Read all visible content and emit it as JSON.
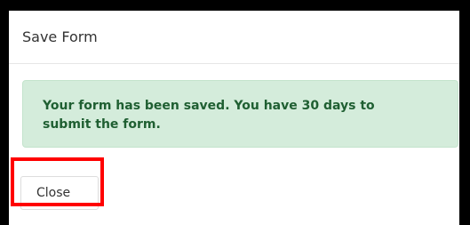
{
  "dialog": {
    "title": "Save Form",
    "message": "Your form has been saved. You have 30 days to submit the form.",
    "close_label": "Close"
  },
  "colors": {
    "alert_background": "#d4ecdb",
    "alert_text": "#1f5f32",
    "highlight": "#ff0000"
  }
}
